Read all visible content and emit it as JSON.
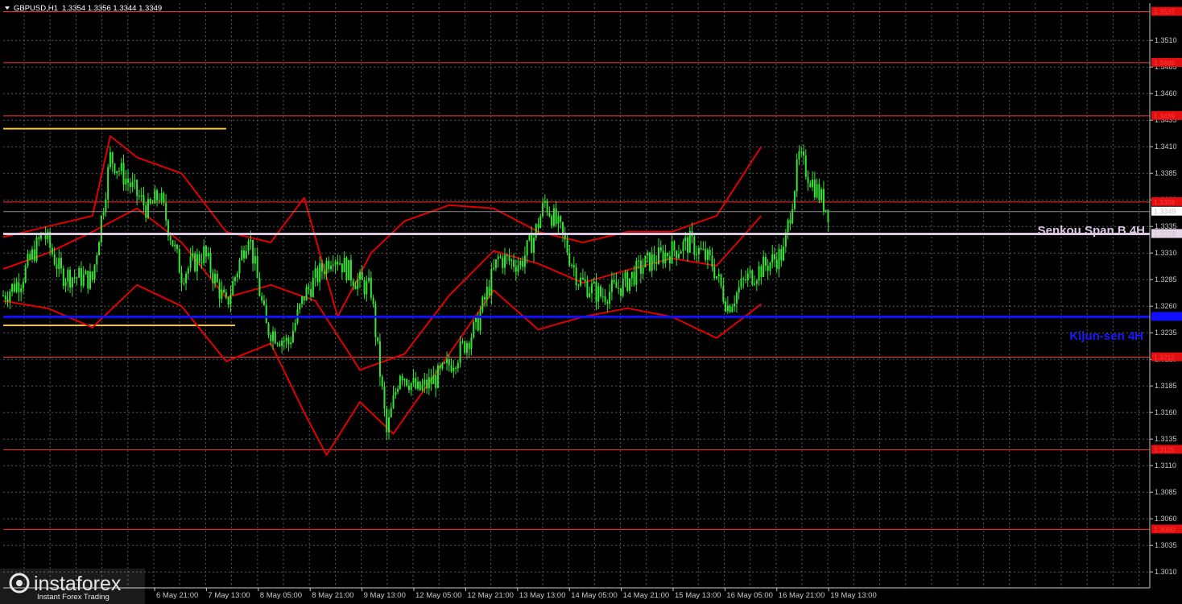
{
  "header": {
    "symbol": "GBPUSD,H1",
    "quote": "1.3354 1.3356 1.3344 1.3349"
  },
  "watermark": {
    "brand": "instaforex",
    "tagline": "Instant Forex Trading"
  },
  "chart_data": {
    "type": "candlestick",
    "symbol": "GBPUSD",
    "timeframe": "H1",
    "ylim": [
      1.2995,
      1.3545
    ],
    "yticks": [
      "1.3510",
      "1.3485",
      "1.3460",
      "1.3435",
      "1.3410",
      "1.3385",
      "1.3360",
      "1.3335",
      "1.3310",
      "1.3285",
      "1.3260",
      "1.3235",
      "1.3210",
      "1.3185",
      "1.3160",
      "1.3135",
      "1.3110",
      "1.3085",
      "1.3060",
      "1.3035",
      "1.3010"
    ],
    "xticks": [
      "6 May 21:00",
      "7 May 13:00",
      "8 May 05:00",
      "8 May 21:00",
      "9 May 13:00",
      "12 May 05:00",
      "12 May 21:00",
      "13 May 13:00",
      "14 May 05:00",
      "14 May 21:00",
      "15 May 13:00",
      "16 May 05:00",
      "16 May 21:00",
      "19 May 13:00"
    ],
    "price_levels": [
      {
        "value": 1.3537,
        "label": "1.3537",
        "color": "#ff3030"
      },
      {
        "value": 1.3489,
        "label": "1.3489",
        "color": "#ff3030"
      },
      {
        "value": 1.3439,
        "label": "1.3439",
        "color": "#ff3030"
      },
      {
        "value": 1.3358,
        "label": "1.3358",
        "color": "#ff3030"
      },
      {
        "value": 1.3212,
        "label": "1.3212",
        "color": "#ff3030"
      },
      {
        "value": 1.3125,
        "label": "1.3125",
        "color": "#ff3030"
      },
      {
        "value": 1.305,
        "label": "1.3050",
        "color": "#ff3030"
      }
    ],
    "current_price": {
      "value": 1.3349,
      "label": "1.3349"
    },
    "senkou_span_b": {
      "value": 1.3328,
      "label": "1.3328",
      "name": "Senkou Span B 4H",
      "color": "#d9c8df"
    },
    "kijun_sen": {
      "value": 1.325,
      "name": "Kijun-sen 4H",
      "color": "#1010ff"
    },
    "support_resistance": [
      {
        "value": 1.3427,
        "from_hour": 0,
        "to_hour": 100,
        "color": "#f5c518"
      },
      {
        "value": 1.3242,
        "from_hour": 0,
        "to_hour": 104,
        "color": "#f5c518"
      }
    ],
    "bollinger_middle": [
      [
        0,
        1.3295
      ],
      [
        20,
        1.331
      ],
      [
        40,
        1.333
      ],
      [
        60,
        1.3352
      ],
      [
        80,
        1.332
      ],
      [
        100,
        1.3268
      ],
      [
        120,
        1.328
      ],
      [
        140,
        1.3265
      ],
      [
        160,
        1.32
      ],
      [
        180,
        1.3215
      ],
      [
        200,
        1.327
      ],
      [
        220,
        1.3312
      ],
      [
        240,
        1.33
      ],
      [
        260,
        1.3282
      ],
      [
        280,
        1.3294
      ],
      [
        300,
        1.3305
      ],
      [
        320,
        1.3298
      ],
      [
        340,
        1.3345
      ]
    ],
    "bollinger_upper": [
      [
        0,
        1.3325
      ],
      [
        20,
        1.3335
      ],
      [
        40,
        1.3345
      ],
      [
        48,
        1.342
      ],
      [
        60,
        1.34
      ],
      [
        80,
        1.3385
      ],
      [
        100,
        1.333
      ],
      [
        120,
        1.332
      ],
      [
        135,
        1.3362
      ],
      [
        150,
        1.325
      ],
      [
        165,
        1.331
      ],
      [
        180,
        1.334
      ],
      [
        200,
        1.3355
      ],
      [
        220,
        1.3352
      ],
      [
        240,
        1.333
      ],
      [
        260,
        1.332
      ],
      [
        280,
        1.333
      ],
      [
        300,
        1.333
      ],
      [
        320,
        1.3345
      ],
      [
        340,
        1.341
      ]
    ],
    "bollinger_lower": [
      [
        0,
        1.3265
      ],
      [
        20,
        1.3258
      ],
      [
        40,
        1.324
      ],
      [
        60,
        1.328
      ],
      [
        80,
        1.326
      ],
      [
        100,
        1.3208
      ],
      [
        120,
        1.3225
      ],
      [
        135,
        1.316
      ],
      [
        145,
        1.312
      ],
      [
        160,
        1.317
      ],
      [
        175,
        1.314
      ],
      [
        195,
        1.32
      ],
      [
        220,
        1.3275
      ],
      [
        240,
        1.3238
      ],
      [
        260,
        1.325
      ],
      [
        280,
        1.3258
      ],
      [
        300,
        1.325
      ],
      [
        320,
        1.323
      ],
      [
        340,
        1.3262
      ]
    ],
    "price_path": [
      [
        0,
        1.327
      ],
      [
        8,
        1.3285
      ],
      [
        18,
        1.333
      ],
      [
        26,
        1.329
      ],
      [
        40,
        1.3285
      ],
      [
        48,
        1.34
      ],
      [
        55,
        1.338
      ],
      [
        65,
        1.335
      ],
      [
        70,
        1.3365
      ],
      [
        80,
        1.329
      ],
      [
        90,
        1.331
      ],
      [
        100,
        1.326
      ],
      [
        110,
        1.333
      ],
      [
        118,
        1.324
      ],
      [
        128,
        1.3225
      ],
      [
        135,
        1.327
      ],
      [
        148,
        1.331
      ],
      [
        158,
        1.3285
      ],
      [
        165,
        1.3275
      ],
      [
        172,
        1.314
      ],
      [
        178,
        1.32
      ],
      [
        186,
        1.318
      ],
      [
        196,
        1.3195
      ],
      [
        204,
        1.3215
      ],
      [
        212,
        1.324
      ],
      [
        222,
        1.3305
      ],
      [
        232,
        1.33
      ],
      [
        238,
        1.3325
      ],
      [
        243,
        1.3358
      ],
      [
        250,
        1.333
      ],
      [
        258,
        1.3285
      ],
      [
        268,
        1.327
      ],
      [
        278,
        1.328
      ],
      [
        288,
        1.33
      ],
      [
        298,
        1.331
      ],
      [
        308,
        1.332
      ],
      [
        318,
        1.33
      ],
      [
        325,
        1.326
      ],
      [
        333,
        1.3285
      ],
      [
        343,
        1.33
      ],
      [
        350,
        1.331
      ],
      [
        357,
        1.34
      ],
      [
        366,
        1.3365
      ],
      [
        370,
        1.3349
      ]
    ]
  }
}
